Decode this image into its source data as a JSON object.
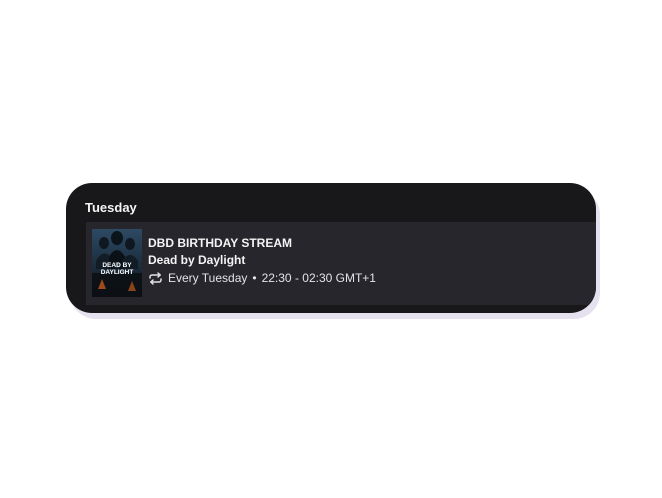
{
  "schedule": {
    "day": "Tuesday",
    "event": {
      "title": "DBD BIRTHDAY STREAM",
      "game": "Dead by Daylight",
      "recurrence": "Every Tuesday",
      "separator": "•",
      "time": "22:30 - 02:30 GMT+1",
      "cover_art_text": [
        "DEAD BY",
        "DAYLIGHT"
      ],
      "icon": "repeat-icon"
    }
  },
  "colors": {
    "card_bg": "#18181b",
    "row_bg": "#26262c",
    "text": "#f4f4f5",
    "shadow": "#e6e1ef"
  }
}
